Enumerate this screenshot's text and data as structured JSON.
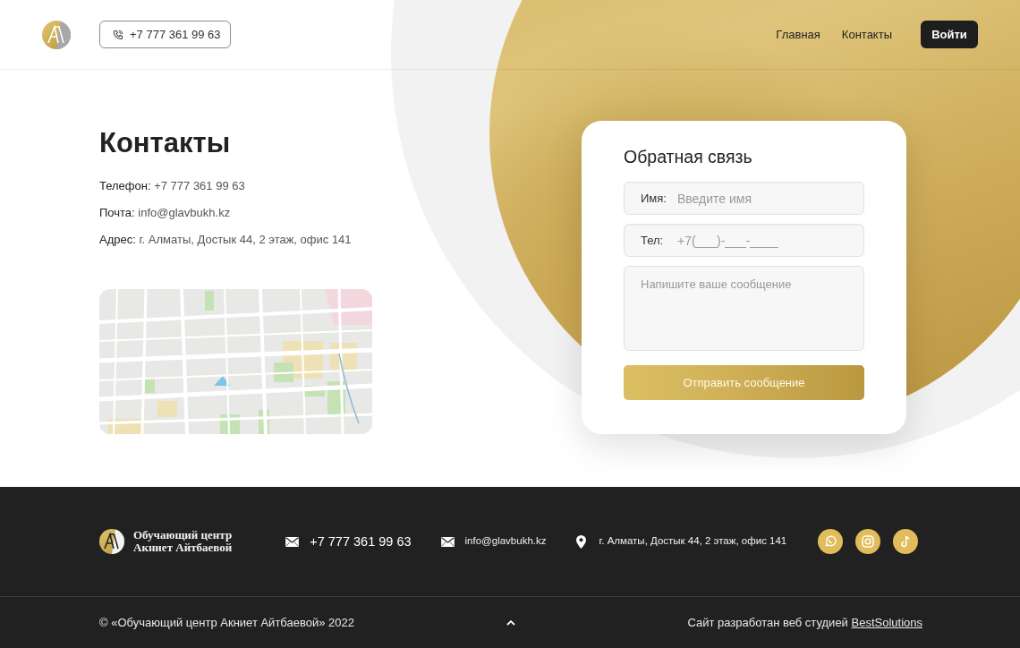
{
  "header": {
    "phone": "+7 777 361 99 63",
    "nav": [
      "Главная",
      "Контакты"
    ],
    "login": "Войти"
  },
  "contacts": {
    "title": "Контакты",
    "lines": [
      {
        "label": "Телефон:",
        "value": "+7 777 361 99 63"
      },
      {
        "label": "Почта:",
        "value": "info@glavbukh.kz"
      },
      {
        "label": "Адрес:",
        "value": "г. Алматы, Достык 44, 2 этаж, офис 141"
      }
    ]
  },
  "form": {
    "title": "Обратная связь",
    "fields": [
      {
        "kind": "input",
        "label": "Имя:",
        "placeholder": "Введите имя"
      },
      {
        "kind": "input",
        "label": "Тел:",
        "placeholder": "+7(___)-___-____"
      },
      {
        "kind": "textarea",
        "placeholder": "Напишите ваше сообщение"
      }
    ],
    "submit": "Отправить сообщение"
  },
  "footer": {
    "brand": [
      "Обучающий центр",
      "Акниет Айтбаевой"
    ],
    "contacts": [
      {
        "kind": "phone",
        "text": "+7 777 361 99 63"
      },
      {
        "kind": "email",
        "text": "info@glavbukh.kz"
      },
      {
        "kind": "address",
        "text": "г. Алматы, Достык 44, 2 этаж, офис 141"
      }
    ],
    "socials": [
      {
        "kind": "chat"
      },
      {
        "kind": "camera"
      },
      {
        "kind": "note"
      }
    ],
    "copyright": "© «Обучающий центр Акниет Айтбаевой» 2022",
    "credit": {
      "text": "Сайт разработан веб студией",
      "link": "BestSolutions"
    }
  }
}
